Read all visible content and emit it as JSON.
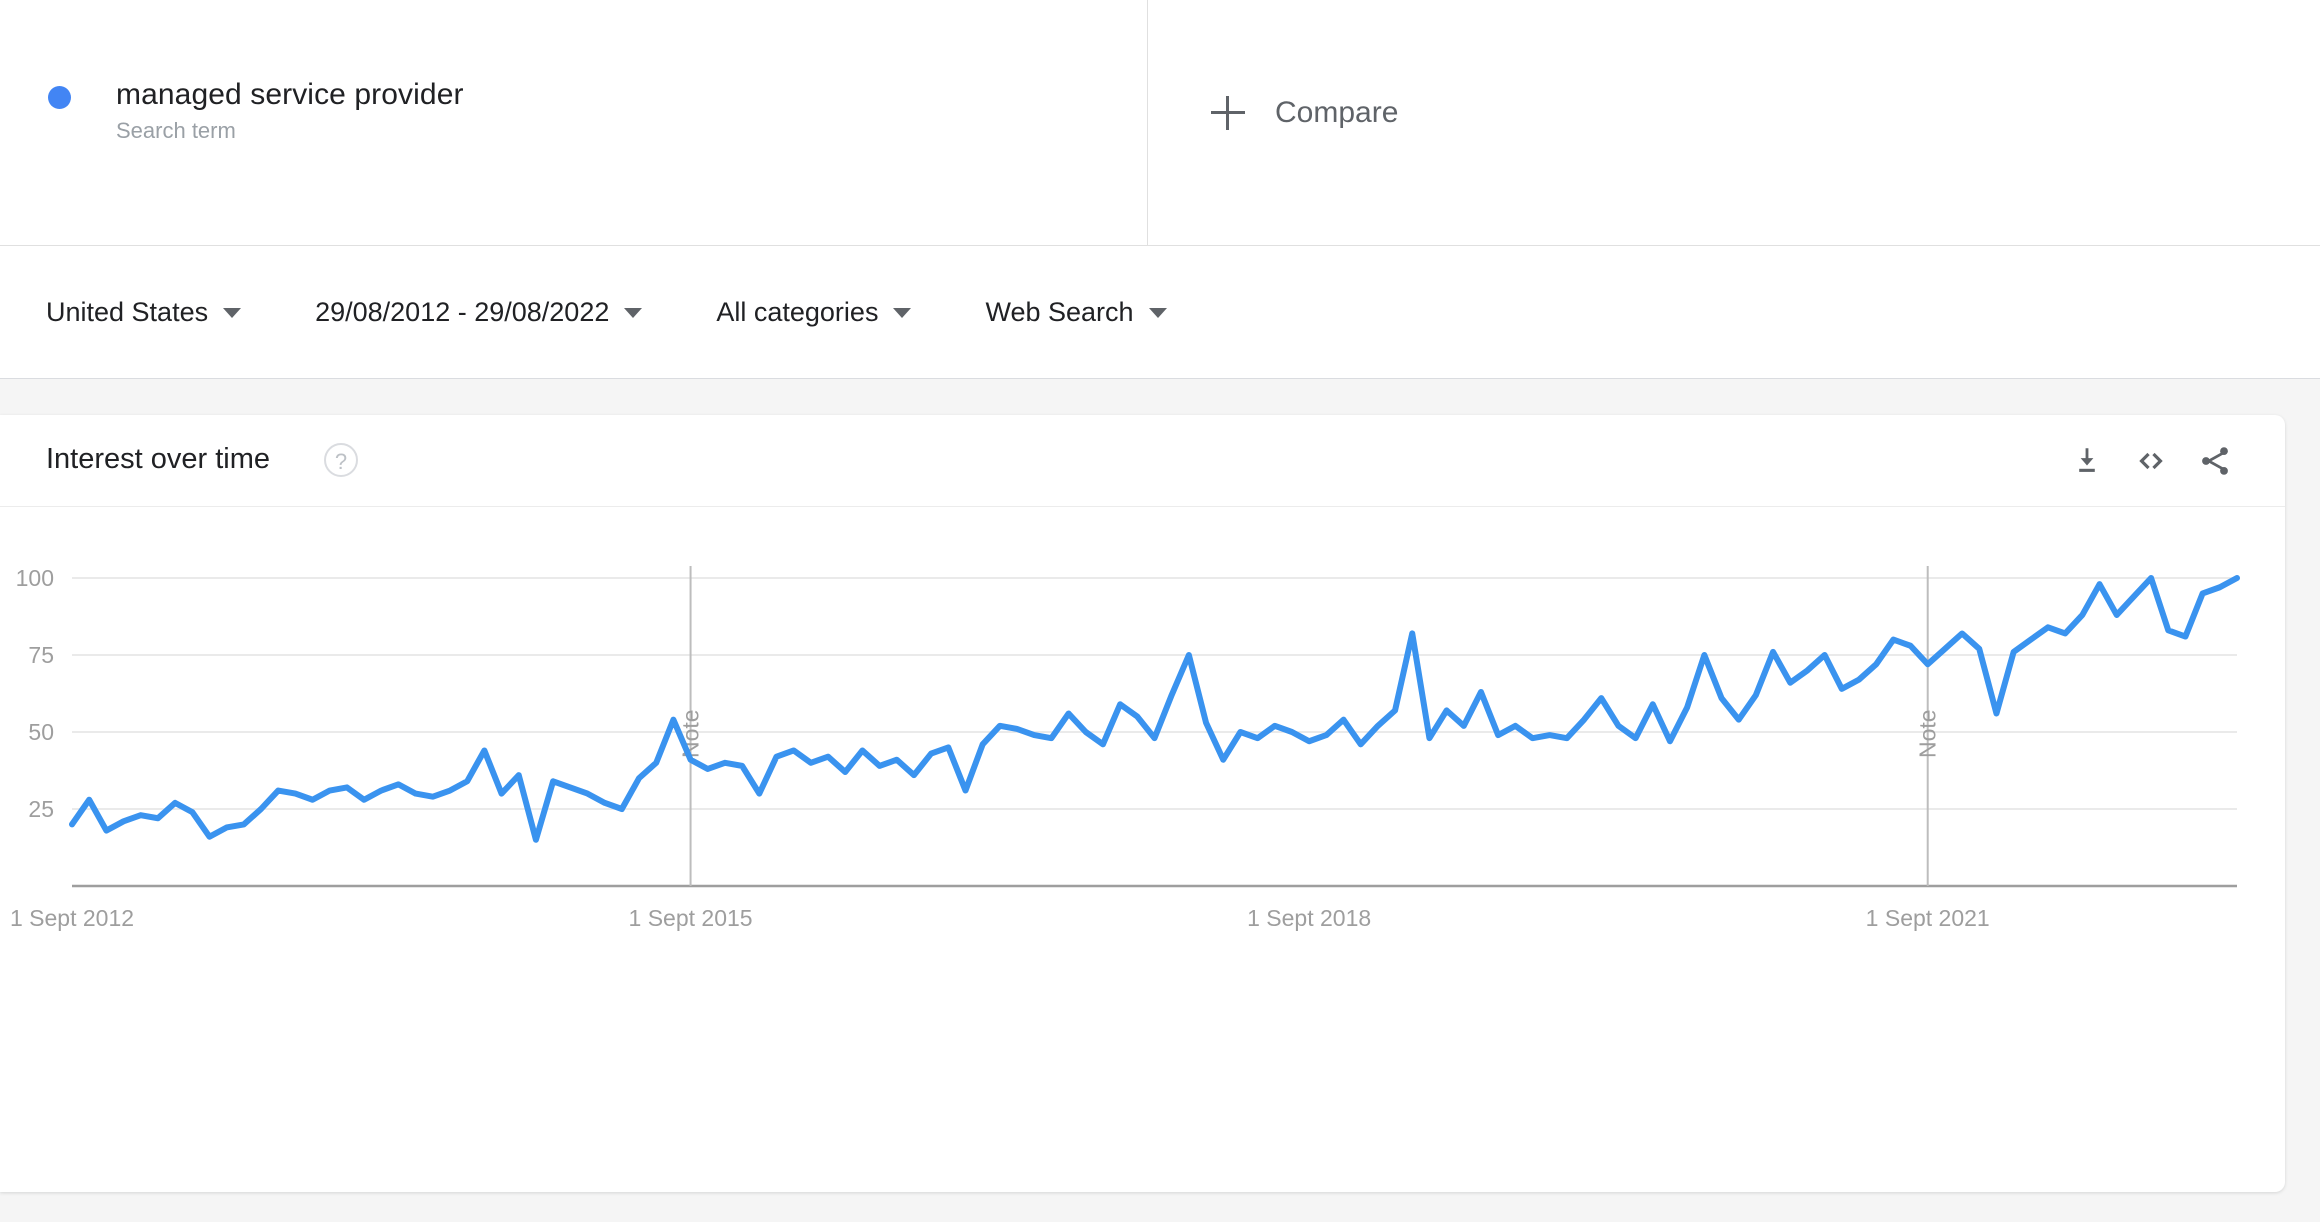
{
  "term": {
    "title": "managed service provider",
    "subtitle": "Search term",
    "dot_color": "#4285f4"
  },
  "compare": {
    "label": "Compare",
    "icon": "plus-icon"
  },
  "filters": [
    {
      "label": "United States",
      "name": "location"
    },
    {
      "label": "29/08/2012 - 29/08/2022",
      "name": "date-range"
    },
    {
      "label": "All categories",
      "name": "category"
    },
    {
      "label": "Web Search",
      "name": "search-type"
    }
  ],
  "card": {
    "title": "Interest over time",
    "help_icon": "?",
    "actions": [
      {
        "name": "download-icon",
        "label": "Download"
      },
      {
        "name": "embed-icon",
        "label": "Embed"
      },
      {
        "name": "share-icon",
        "label": "Share"
      }
    ]
  },
  "chart_data": {
    "type": "line",
    "title": "Interest over time",
    "xlabel": "",
    "ylabel": "",
    "ylim": [
      0,
      100
    ],
    "yticks": [
      25,
      50,
      75,
      100
    ],
    "xticks": [
      "1 Sept 2012",
      "1 Sept 2015",
      "1 Sept 2018",
      "1 Sept 2021"
    ],
    "xtick_positions": [
      0,
      36,
      72,
      108
    ],
    "grid": true,
    "legend": "none",
    "line_color": "#3a93ef",
    "annotations": [
      {
        "label": "Note",
        "x_index": 36
      },
      {
        "label": "Note",
        "x_index": 108
      }
    ],
    "series": [
      {
        "name": "managed service provider",
        "values": [
          20,
          28,
          18,
          21,
          23,
          22,
          27,
          24,
          16,
          19,
          20,
          25,
          31,
          30,
          28,
          31,
          32,
          28,
          31,
          33,
          30,
          29,
          31,
          34,
          44,
          30,
          36,
          15,
          34,
          32,
          30,
          27,
          25,
          35,
          40,
          54,
          41,
          38,
          40,
          39,
          30,
          42,
          44,
          40,
          42,
          37,
          44,
          39,
          41,
          36,
          43,
          45,
          31,
          46,
          52,
          51,
          49,
          48,
          56,
          50,
          46,
          59,
          55,
          48,
          62,
          75,
          53,
          41,
          50,
          48,
          52,
          50,
          47,
          49,
          54,
          46,
          52,
          57,
          82,
          48,
          57,
          52,
          63,
          49,
          52,
          48,
          49,
          48,
          54,
          61,
          52,
          48,
          59,
          47,
          58,
          75,
          61,
          54,
          62,
          76,
          66,
          70,
          75,
          64,
          67,
          72,
          80,
          78,
          72,
          77,
          82,
          77,
          56,
          76,
          80,
          84,
          82,
          88,
          98,
          88,
          94,
          100,
          83,
          81,
          95,
          97,
          100
        ]
      }
    ]
  }
}
